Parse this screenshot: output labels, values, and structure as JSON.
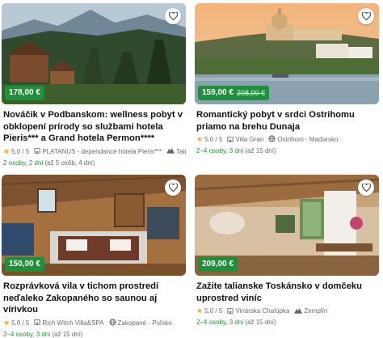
{
  "cards": [
    {
      "price": "178,00 €",
      "old_price": "",
      "title": "Nováčik v Podbanskom: wellness pobyt v obklopení prírody so službami hotela Pieris*** a Grand hotela Permon****",
      "rating": "5,0 / 5",
      "hotel": "PLATANUS - dependance hotela Pieris***",
      "location": "Tatry",
      "location_icon": "mountain-icon",
      "duration": "2 osoby, 2 dni",
      "duration_extra": "(až 5 osôb, 4 dni)"
    },
    {
      "price": "159,00 €",
      "old_price": "208,00 €",
      "title": "Romantický pobyt v srdci Ostrihomu priamo na brehu Dunaja",
      "rating": "5,0 / 5",
      "hotel": "Villa Gran",
      "location": "Ostrihom - Maďarsko",
      "location_icon": "globe-icon",
      "duration": "2–4 osoby, 3 dni",
      "duration_extra": "(až 15 dní)"
    },
    {
      "price": "150,00 €",
      "old_price": "",
      "title": "Rozprávková vila v tichom prostredí neďaleko Zakopaného so saunou aj vírivkou",
      "rating": "5,0 / 5",
      "hotel": "Rich Witch Villa&SPA",
      "location": "Zakopané - Poľsko",
      "location_icon": "globe-icon",
      "duration": "2–4 osoby, 3 dni",
      "duration_extra": "(až 15 dní)"
    },
    {
      "price": "209,00 €",
      "old_price": "",
      "title": "Zažite talianske Toskánsko v domčeku uprostred viníc",
      "rating": "5,0 / 5",
      "hotel": "Vinárska Chalúpka",
      "location": "Zemplín",
      "location_icon": "mountain-icon",
      "duration": "2–4 osoby, 3 dni",
      "duration_extra": "(až 15 dní)"
    }
  ],
  "colors": {
    "accent": "#1e8f3a",
    "star": "#f0a81f"
  }
}
